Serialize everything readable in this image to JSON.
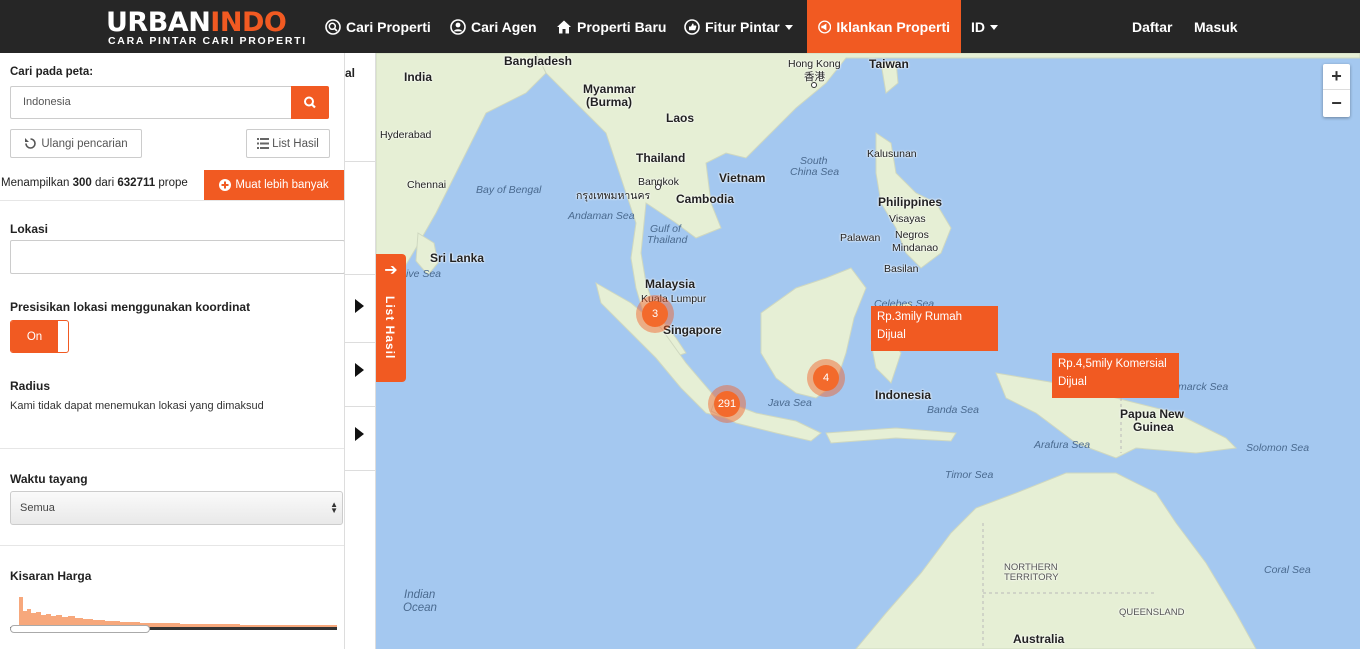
{
  "brand": {
    "name_part1": "URBAN",
    "name_part2": "INDO",
    "tagline": "CARA PINTAR CARI PROPERTI"
  },
  "nav": {
    "cari_properti": "Cari Properti",
    "cari_agen": "Cari Agen",
    "properti_baru": "Properti Baru",
    "fitur_pintar": "Fitur Pintar",
    "iklankan": "Iklankan Properti",
    "lang": "ID",
    "daftar": "Daftar",
    "masuk": "Masuk"
  },
  "panel": {
    "search_label": "Cari pada peta:",
    "search_value": "Indonesia",
    "reset_label": "Ulangi pencarian",
    "list_label": "List Hasil",
    "count_prefix": "Menampilkan",
    "count_shown": "300",
    "count_mid": "dari",
    "count_total": "632711",
    "count_suffix": "prope",
    "load_more": "Muat lebih banyak",
    "lokasi_label": "Lokasi",
    "presisi_label": "Presisikan lokasi menggunakan koordinat",
    "toggle_on": "On",
    "radius_label": "Radius",
    "radius_msg": "Kami tidak dapat menemukan lokasi yang dimaksud",
    "waktu_label": "Waktu tayang",
    "waktu_value": "Semua",
    "harga_label": "Kisaran Harga"
  },
  "strip": {
    "fragment": "al"
  },
  "map": {
    "list_tab": "List Hasil",
    "zoom_in": "+",
    "zoom_out": "−",
    "clusters": {
      "c3": "3",
      "c291": "291",
      "c4": "4"
    },
    "price1_line1": "Rp.3mily Rumah",
    "price1_line2": "Dijual",
    "price2_line1": "Rp.4,5mily Komersial",
    "price2_line2": "Dijual",
    "labels": {
      "india": "India",
      "bangladesh": "Bangladesh",
      "myanmar1": "Myanmar",
      "myanmar2": "(Burma)",
      "hongkong1": "Hong Kong",
      "hongkong2": "香港",
      "taiwan": "Taiwan",
      "laos": "Laos",
      "thailand": "Thailand",
      "bangkok1": "Bangkok",
      "bangkok2": "กรุงเทพมหานคร",
      "vietnam": "Vietnam",
      "cambodia": "Cambodia",
      "hyderabad": "Hyderabad",
      "chennai": "Chennai",
      "bayofbengal": "Bay of Bengal",
      "andaman": "Andaman Sea",
      "gulf1": "Gulf of",
      "gulf2": "Thailand",
      "southchina1": "South",
      "southchina2": "China Sea",
      "kalusunan": "Kalusunan",
      "philippines": "Philippines",
      "visayas": "Visayas",
      "negros": "Negros",
      "mindanao": "Mindanao",
      "palawan": "Palawan",
      "basilan": "Basilan",
      "srilanka": "Sri Lanka",
      "laccadive": "ive Sea",
      "malaysia": "Malaysia",
      "kualalumpur": "Kuala Lumpur",
      "singapore": "Singapore",
      "celebes": "Celebes Sea",
      "indonesia": "Indonesia",
      "javasea": "Java Sea",
      "bandasea": "Banda Sea",
      "arafura": "Arafura Sea",
      "timor": "Timor Sea",
      "papua1": "Papua New",
      "papua2": "Guinea",
      "bismarck": "marck Sea",
      "solomon": "Solomon Sea",
      "indianocean1": "Indian",
      "indianocean2": "Ocean",
      "northern1": "NORTHERN",
      "northern2": "TERRITORY",
      "queensland": "QUEENSLAND",
      "coral": "Coral Sea",
      "australia": "Australia"
    }
  }
}
